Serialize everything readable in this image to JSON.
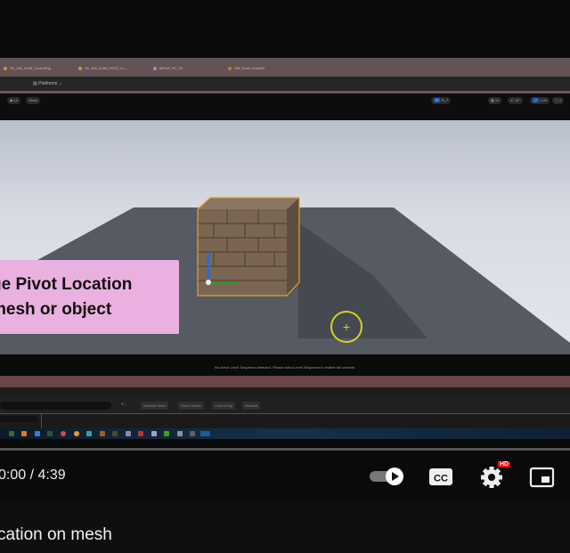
{
  "editor": {
    "tabs": [
      {
        "label": "SK_Mill_Smiff_ControlRig",
        "color": "#c49a3a"
      },
      {
        "label": "SK_Mill_Smiff_FKFK_Co...",
        "color": "#c49a3a"
      },
      {
        "label": "MESH_PC_03",
        "color": "#c07ad0"
      },
      {
        "label": "WB_Smiff_AnimBP",
        "color": "#c47a3a"
      }
    ],
    "platforms_label": "Platforms",
    "viewport_toolbar": {
      "lit": "Lit",
      "show": "Show",
      "grid": "10",
      "angle": "10°",
      "scale": "0.25",
      "camera": "4"
    },
    "overlay_caption": [
      "ge Pivot Location",
      "mesh or object"
    ],
    "sequencer_message": "No active Level Sequence detected. Please edit a Level Sequence to enable full controls.",
    "filters": [
      "Skeletal Mesh",
      "Sound Wave",
      "Control Rig",
      "Material"
    ]
  },
  "player": {
    "time": "0:00 / 4:39",
    "progress_percent": 0,
    "autoplay_on": true,
    "quality_badge": "HD",
    "accent": "#ff0000"
  },
  "video_title": "cation on mesh"
}
